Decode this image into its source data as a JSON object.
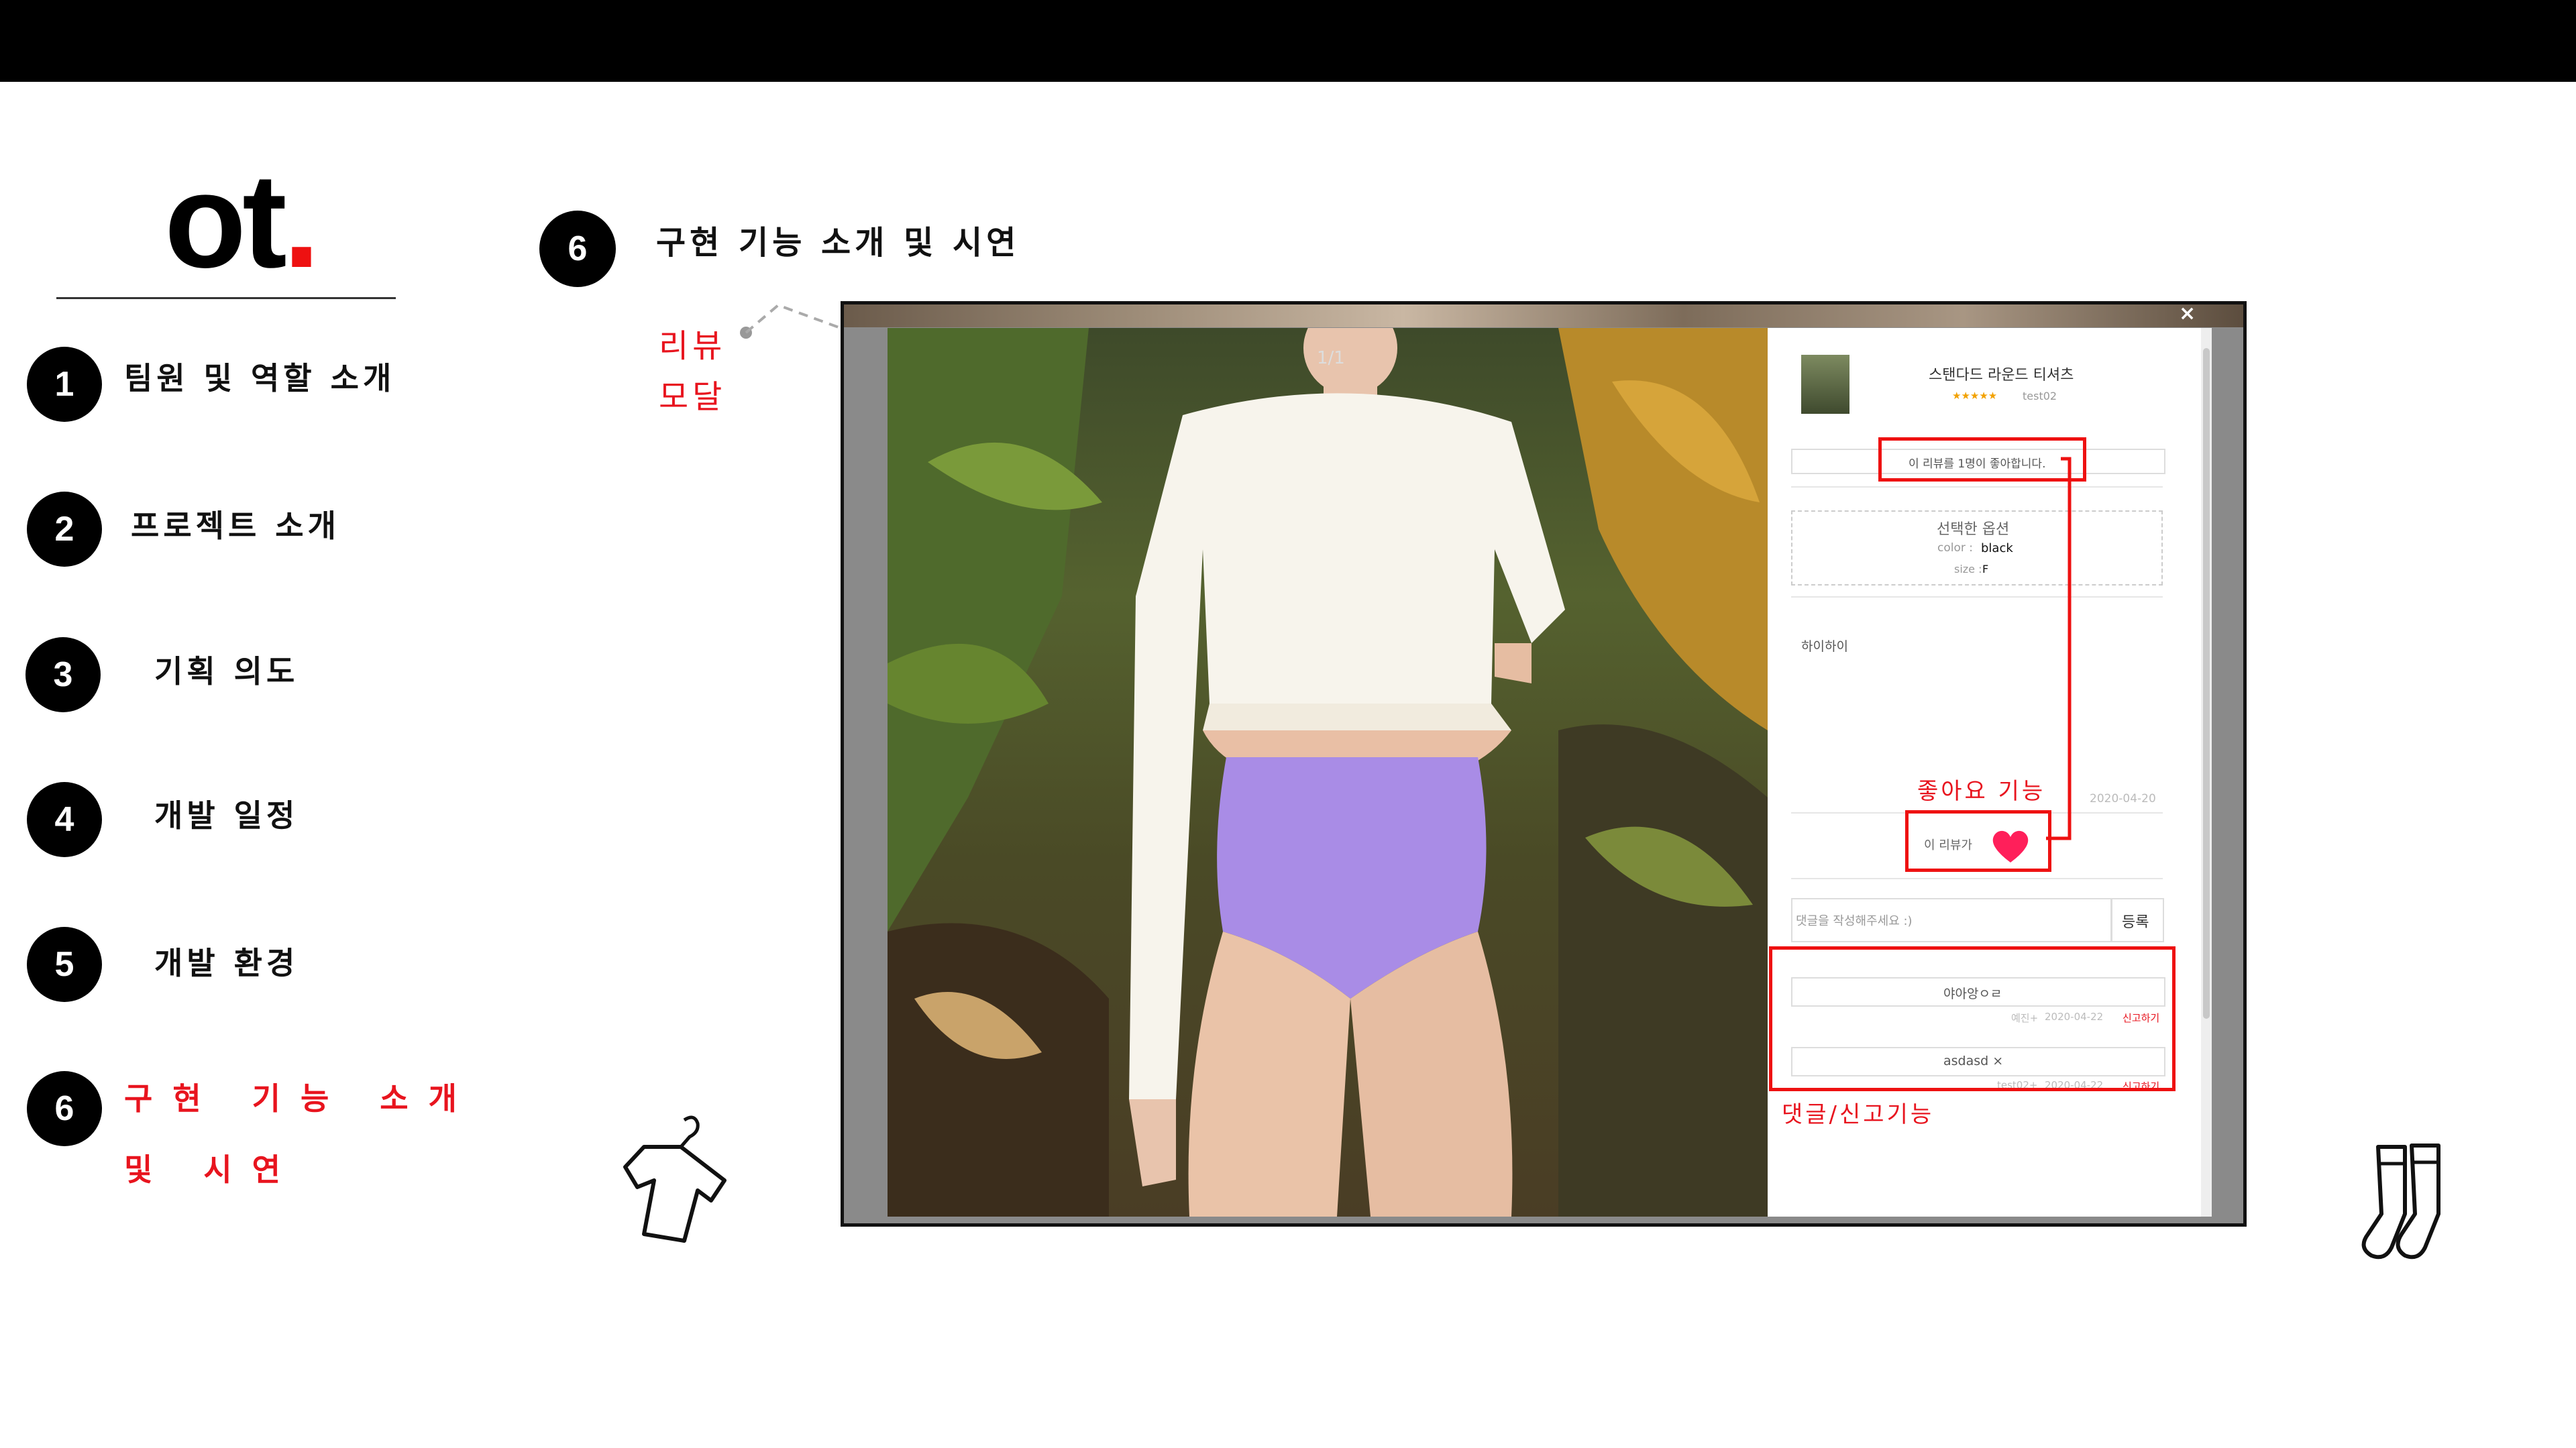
{
  "logo": {
    "text": "ot",
    "dot": "."
  },
  "nav": [
    {
      "num": "1",
      "label": "팀원 및 역할 소개"
    },
    {
      "num": "2",
      "label": "프로젝트 소개"
    },
    {
      "num": "3",
      "label": "기획 의도"
    },
    {
      "num": "4",
      "label": "개발 일정"
    },
    {
      "num": "5",
      "label": "개발 환경"
    },
    {
      "num": "6",
      "label": "구현 기능 소개 및 시연"
    }
  ],
  "section": {
    "num": "6",
    "title": "구현 기능 소개 및 시연"
  },
  "annotations": {
    "review_modal": "리뷰\n모달",
    "like": "좋아요 기능",
    "comment_report": "댓글/신고기능"
  },
  "modal": {
    "close": "×",
    "pager": "1/1",
    "product_name": "스탠다드 라운드 티셔츠",
    "stars": "★★★★★",
    "author": "test02",
    "like_count_text": "이 리뷰를 1명이 좋아합니다.",
    "option_title": "선택한 옵션",
    "color_label": "color :",
    "color_value": "black",
    "size_label": "size :",
    "size_value": "F",
    "review_text": "하이하이",
    "review_date": "2020-04-20",
    "like_label": "이 리뷰가",
    "comment_placeholder": "댓글을 작성해주세요 :)",
    "submit": "등록",
    "comments": [
      {
        "text": "야아앙ㅇㄹ",
        "user": "예진+",
        "date": "2020-04-22",
        "report": "신고하기"
      },
      {
        "text": "asdasd ×",
        "user": "test02+",
        "date": "2020-04-22",
        "report": "신고하기"
      }
    ]
  },
  "colors": {
    "accent": "#e8141e",
    "heart": "#ff1f5a"
  }
}
